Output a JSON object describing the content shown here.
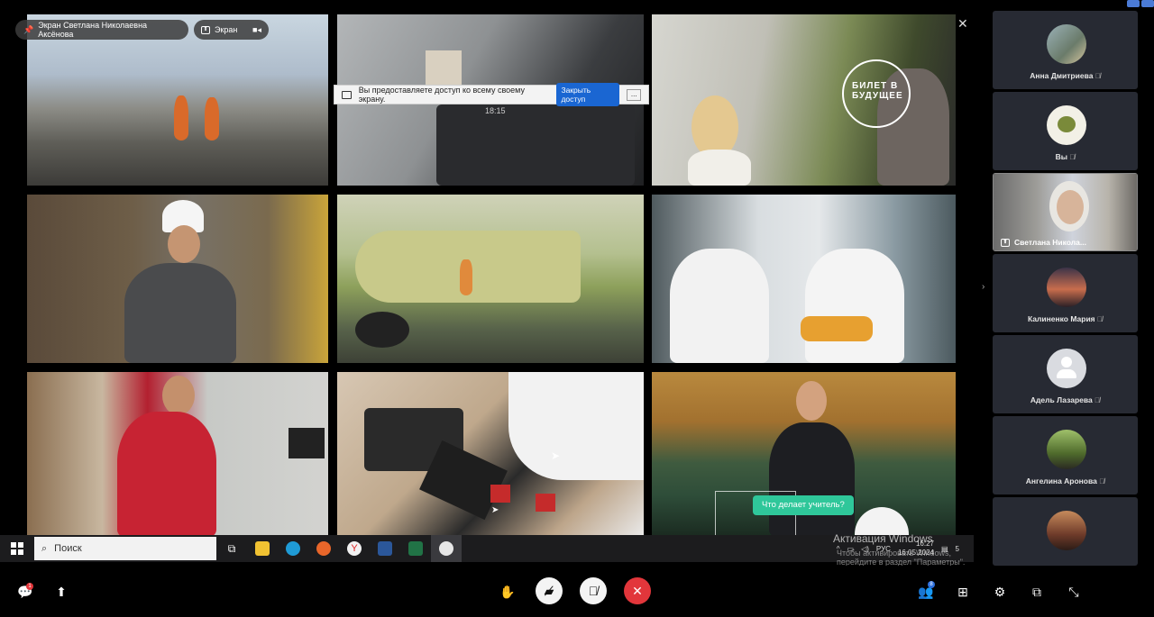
{
  "screen_share": {
    "presenter_label": "Экран Светлана Николаевна Аксёнова",
    "screen_chip_label": "Экран",
    "sharing_notice": "Вы предоставляете доступ ко всему своему экрану.",
    "stop_sharing_button": "Закрыть доступ",
    "minimize_label": "...",
    "laptop_clock": "18:15",
    "logo_text_line1": "БИЛЕТ В",
    "logo_text_line2": "БУДУЩЕЕ",
    "chat_bubble_text": "Что делает учитель?"
  },
  "taskbar": {
    "search_placeholder": "Поиск",
    "language": "РУС",
    "time": "16:27",
    "date": "16.05.2024",
    "notifications_count": "5",
    "apps": [
      "file-explorer-icon",
      "edge-icon",
      "firefox-icon",
      "yandex-icon",
      "word-icon",
      "excel-icon",
      "media-player-icon"
    ]
  },
  "windows_activation": {
    "title": "Активация Windows",
    "subtitle": "Чтобы активировать Windows, перейдите в раздел \"Параметры\"."
  },
  "participants": [
    {
      "name": "Анна Дмитриева",
      "muted": true
    },
    {
      "name": "Вы",
      "muted": true
    },
    {
      "name": "Светлана Никола...",
      "muted": false,
      "camera_on": true,
      "presenting": true
    },
    {
      "name": "Калиненко Мария",
      "muted": true
    },
    {
      "name": "Адель Лазарева",
      "muted": true
    },
    {
      "name": "Ангелина Аронова",
      "muted": true
    },
    {
      "name": "",
      "muted": true
    }
  ],
  "controls": {
    "chat_badge": "1",
    "participants_badge": "8"
  },
  "colors": {
    "accent_blue": "#2d6fdc",
    "end_call_red": "#e2363b",
    "bubble_green": "#2fc79a",
    "panel_card": "#272a33"
  }
}
